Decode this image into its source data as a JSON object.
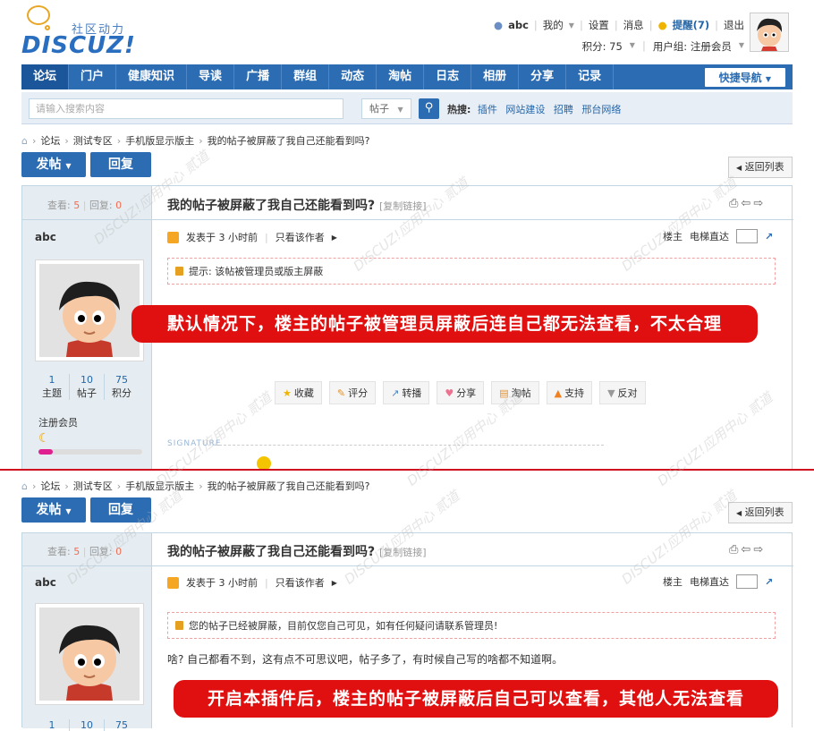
{
  "header": {
    "logo_sub": "社区动力",
    "logo_text": "DISCUZ!",
    "user": "abc",
    "my": "我的",
    "settings": "设置",
    "messages": "消息",
    "reminder": "提醒(7)",
    "logout": "退出",
    "points": "积分: 75",
    "usergroup": "用户组: 注册会员"
  },
  "nav": {
    "items": [
      "论坛",
      "门户",
      "健康知识",
      "导读",
      "广播",
      "群组",
      "动态",
      "淘帖",
      "日志",
      "相册",
      "分享",
      "记录"
    ],
    "quick": "快捷导航"
  },
  "search": {
    "placeholder": "请输入搜索内容",
    "type": "帖子",
    "hot_label": "热搜:",
    "hot": [
      "插件",
      "网站建设",
      "招聘",
      "邢台网络"
    ]
  },
  "breadcrumb": [
    "论坛",
    "测试专区",
    "手机版显示版主",
    "我的帖子被屏蔽了我自己还能看到吗?"
  ],
  "buttons": {
    "post": "发帖",
    "reply": "回复",
    "back": "返回列表"
  },
  "thread": {
    "views_label": "查看:",
    "views": "5",
    "replies_label": "回复:",
    "replies": "0",
    "title": "我的帖子被屏蔽了我自己还能看到吗?",
    "copy_link": "[复制链接]",
    "author": "abc",
    "posted": "发表于 3 小时前",
    "only_author": "只看该作者",
    "owner": "楼主",
    "elevator": "电梯直达"
  },
  "profile": {
    "stats": [
      {
        "value": "1",
        "label": "主题"
      },
      {
        "value": "10",
        "label": "帖子"
      },
      {
        "value": "75",
        "label": "积分"
      }
    ],
    "group": "注册会员"
  },
  "panel1": {
    "tip": "提示: 该帖被管理员或版主屏蔽",
    "banner": "默认情况下，楼主的帖子被管理员屏蔽后连自己都无法查看，不太合理",
    "actions": [
      "收藏",
      "评分",
      "转播",
      "分享",
      "淘帖",
      "支持",
      "反对"
    ],
    "signature": "SIGNATURE"
  },
  "panel2": {
    "tip": "您的帖子已经被屏蔽，目前仅您自己可见，如有任何疑问请联系管理员!",
    "content": "啥? 自己都看不到，这有点不可思议吧，帖子多了，有时候自己写的啥都不知道啊。",
    "banner": "开启本插件后，楼主的帖子被屏蔽后自己可以查看，其他人无法查看"
  },
  "colors": {
    "brand": "#2b6cb3",
    "banner": "#e01010",
    "divider": "#d0101e"
  }
}
